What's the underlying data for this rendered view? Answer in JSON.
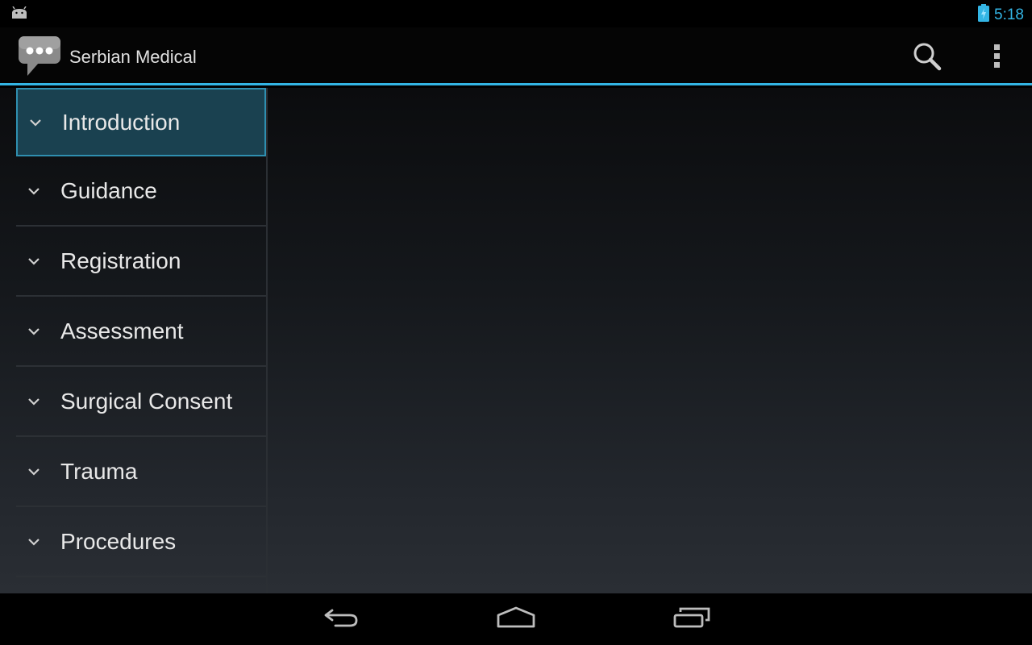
{
  "status_bar": {
    "time": "5:18",
    "notification_icon": "android-icon",
    "battery_icon": "battery-charging-icon"
  },
  "action_bar": {
    "title": "Serbian Medical",
    "app_icon": "chat-bubble-icon",
    "actions": [
      {
        "name": "search",
        "icon": "search-icon"
      },
      {
        "name": "overflow-menu",
        "icon": "more-vertical-icon"
      }
    ]
  },
  "sidebar": {
    "items": [
      {
        "label": "Introduction",
        "selected": true
      },
      {
        "label": "Guidance",
        "selected": false
      },
      {
        "label": "Registration",
        "selected": false
      },
      {
        "label": "Assessment",
        "selected": false
      },
      {
        "label": "Surgical Consent",
        "selected": false
      },
      {
        "label": "Trauma",
        "selected": false
      },
      {
        "label": "Procedures",
        "selected": false
      }
    ]
  },
  "navigation_bar": {
    "buttons": [
      {
        "name": "back",
        "icon": "back-icon"
      },
      {
        "name": "home",
        "icon": "home-icon"
      },
      {
        "name": "recents",
        "icon": "recent-apps-icon"
      }
    ]
  },
  "colors": {
    "accent": "#33b5e5",
    "selected_bg": "#1a4150",
    "selected_border": "#2f8fb0"
  }
}
